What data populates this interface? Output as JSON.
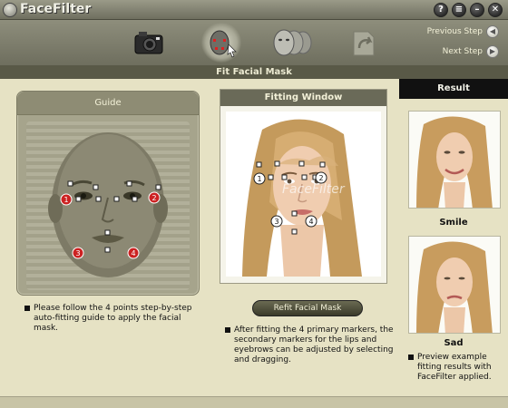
{
  "app": {
    "title": "FaceFilter"
  },
  "window_buttons": [
    {
      "name": "help-button",
      "glyph": "?"
    },
    {
      "name": "menu-button",
      "glyph": "≡"
    },
    {
      "name": "minimize-button",
      "glyph": "–"
    },
    {
      "name": "close-button",
      "glyph": "✕"
    }
  ],
  "toolbar": {
    "steps": [
      {
        "icon": "camera-icon",
        "active": false
      },
      {
        "icon": "face-mask-icon",
        "active": true
      },
      {
        "icon": "faces-icon",
        "active": false
      },
      {
        "icon": "export-icon",
        "active": false
      }
    ],
    "previous_label": "Previous Step",
    "next_label": "Next Step"
  },
  "step_title": "Fit Facial Mask",
  "guide": {
    "title": "Guide",
    "markers": [
      "1",
      "2",
      "3",
      "4"
    ],
    "instruction": "Please follow the 4 points step-by-step auto-fitting guide to apply the facial mask."
  },
  "fitting_window": {
    "title": "Fitting Window",
    "watermark": "FaceFilter",
    "markers": [
      "1",
      "2",
      "3",
      "4"
    ]
  },
  "refit_button": "Refit Facial Mask",
  "fitting_note": "After fitting the 4 primary markers, the secondary markers for the lips and eyebrows can be adjusted by selecting and dragging.",
  "result": {
    "title": "Result",
    "items": [
      {
        "label": "Smile"
      },
      {
        "label": "Sad"
      }
    ],
    "note": "Preview example fitting results with FaceFilter applied."
  },
  "colors": {
    "accent_marker": "#cc2222",
    "toolbar_bg": "#7e7e6c",
    "panel_bg": "#a6a48c"
  }
}
